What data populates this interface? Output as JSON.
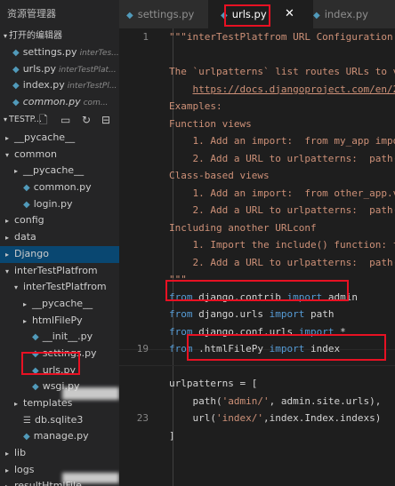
{
  "sidebar": {
    "title": "资源管理器",
    "open_editors_label": "打开的编辑器",
    "open_editors": [
      {
        "name": "settings.py",
        "dir": "interTes..."
      },
      {
        "name": "urls.py",
        "dir": "interTestPlat..."
      },
      {
        "name": "index.py",
        "dir": "interTestPl..."
      },
      {
        "name": "common.py",
        "dir": "com..."
      }
    ],
    "explorer_label": "TESTP...",
    "tree": [
      {
        "label": "__pycache__",
        "arrow": "▸",
        "indent": 0
      },
      {
        "label": "common",
        "arrow": "▾",
        "indent": 0
      },
      {
        "label": "__pycache__",
        "arrow": "▸",
        "indent": 1
      },
      {
        "label": "common.py",
        "arrow": "",
        "indent": 1,
        "py": true
      },
      {
        "label": "login.py",
        "arrow": "",
        "indent": 1,
        "py": true
      },
      {
        "label": "config",
        "arrow": "▸",
        "indent": 0
      },
      {
        "label": "data",
        "arrow": "▸",
        "indent": 0
      },
      {
        "label": "Django",
        "arrow": "▸",
        "indent": 0,
        "selected": true
      },
      {
        "label": "interTestPlatfrom",
        "arrow": "▾",
        "indent": 0
      },
      {
        "label": "interTestPlatfrom",
        "arrow": "▾",
        "indent": 1
      },
      {
        "label": "__pycache__",
        "arrow": "▸",
        "indent": 2
      },
      {
        "label": "htmlFilePy",
        "arrow": "▸",
        "indent": 2
      },
      {
        "label": "__init__.py",
        "arrow": "",
        "indent": 2,
        "py": true
      },
      {
        "label": "settings.py",
        "arrow": "",
        "indent": 2,
        "py": true
      },
      {
        "label": "urls.py",
        "arrow": "",
        "indent": 2,
        "py": true
      },
      {
        "label": "wsgi.py",
        "arrow": "",
        "indent": 2,
        "py": true
      },
      {
        "label": "templates",
        "arrow": "▸",
        "indent": 1
      },
      {
        "label": "db.sqlite3",
        "arrow": "",
        "indent": 1,
        "db": true
      },
      {
        "label": "manage.py",
        "arrow": "",
        "indent": 1,
        "py": true
      },
      {
        "label": "lib",
        "arrow": "▸",
        "indent": 0
      },
      {
        "label": "logs",
        "arrow": "▸",
        "indent": 0
      },
      {
        "label": "resultHtmlFile",
        "arrow": "▸",
        "indent": 0
      }
    ]
  },
  "tabs": [
    {
      "label": "settings.py"
    },
    {
      "label": "urls.py",
      "active": true
    },
    {
      "label": "index.py"
    }
  ],
  "tab_close_glyph": "✕",
  "editor": {
    "lines": [
      {
        "n": "1",
        "tokens": [
          [
            "s",
            "\"\"\"interTestPlatfrom URL Configuration"
          ]
        ]
      },
      {
        "n": "",
        "tokens": []
      },
      {
        "n": "",
        "tokens": [
          [
            "s",
            "The `urlpatterns` list routes URLs to v"
          ]
        ]
      },
      {
        "n": "",
        "tokens": [
          [
            "s",
            "    "
          ],
          [
            "u",
            "https://docs.djangoproject.com/en/2"
          ]
        ]
      },
      {
        "n": "",
        "tokens": [
          [
            "s",
            "Examples:"
          ]
        ]
      },
      {
        "n": "",
        "tokens": [
          [
            "s",
            "Function views"
          ]
        ]
      },
      {
        "n": "",
        "tokens": [
          [
            "s",
            "    1. Add an import:  from my_app impo"
          ]
        ]
      },
      {
        "n": "",
        "tokens": [
          [
            "s",
            "    2. Add a URL to urlpatterns:  path("
          ]
        ]
      },
      {
        "n": "",
        "tokens": [
          [
            "s",
            "Class-based views"
          ]
        ]
      },
      {
        "n": "",
        "tokens": [
          [
            "s",
            "    1. Add an import:  from other_app.v"
          ]
        ]
      },
      {
        "n": "",
        "tokens": [
          [
            "s",
            "    2. Add a URL to urlpatterns:  path("
          ]
        ]
      },
      {
        "n": "",
        "tokens": [
          [
            "s",
            "Including another URLconf"
          ]
        ]
      },
      {
        "n": "",
        "tokens": [
          [
            "s",
            "    1. Import the include() function: f"
          ]
        ]
      },
      {
        "n": "",
        "tokens": [
          [
            "s",
            "    2. Add a URL to urlpatterns:  path("
          ]
        ]
      },
      {
        "n": "",
        "tokens": [
          [
            "s",
            "\"\"\""
          ]
        ]
      },
      {
        "n": "",
        "tokens": [
          [
            "k",
            "from"
          ],
          [
            "t",
            " django.contrib "
          ],
          [
            "k",
            "import"
          ],
          [
            "t",
            " admin"
          ]
        ]
      },
      {
        "n": "",
        "tokens": [
          [
            "k",
            "from"
          ],
          [
            "t",
            " django.urls "
          ],
          [
            "k",
            "import"
          ],
          [
            "t",
            " path"
          ]
        ]
      },
      {
        "n": "",
        "tokens": [
          [
            "k",
            "from"
          ],
          [
            "t",
            " django.conf.urls "
          ],
          [
            "k",
            "import"
          ],
          [
            "t",
            " *"
          ]
        ]
      },
      {
        "n": "19",
        "tokens": [
          [
            "k",
            "from"
          ],
          [
            "t",
            " .htmlFilePy "
          ],
          [
            "k",
            "import"
          ],
          [
            "t",
            " index"
          ]
        ]
      },
      {
        "n": "",
        "tokens": []
      },
      {
        "n": "",
        "tokens": [
          [
            "t",
            "urlpatterns = ["
          ]
        ]
      },
      {
        "n": "",
        "tokens": [
          [
            "t",
            "    path("
          ],
          [
            "s",
            "'admin/'"
          ],
          [
            "t",
            ", admin.site.urls),"
          ]
        ]
      },
      {
        "n": "23",
        "tokens": [
          [
            "t",
            "    url("
          ],
          [
            "s",
            "'index/'"
          ],
          [
            "t",
            ",index.Index.indexs)"
          ]
        ]
      },
      {
        "n": "",
        "tokens": [
          [
            "t",
            "]"
          ]
        ]
      },
      {
        "n": "",
        "tokens": []
      }
    ]
  }
}
